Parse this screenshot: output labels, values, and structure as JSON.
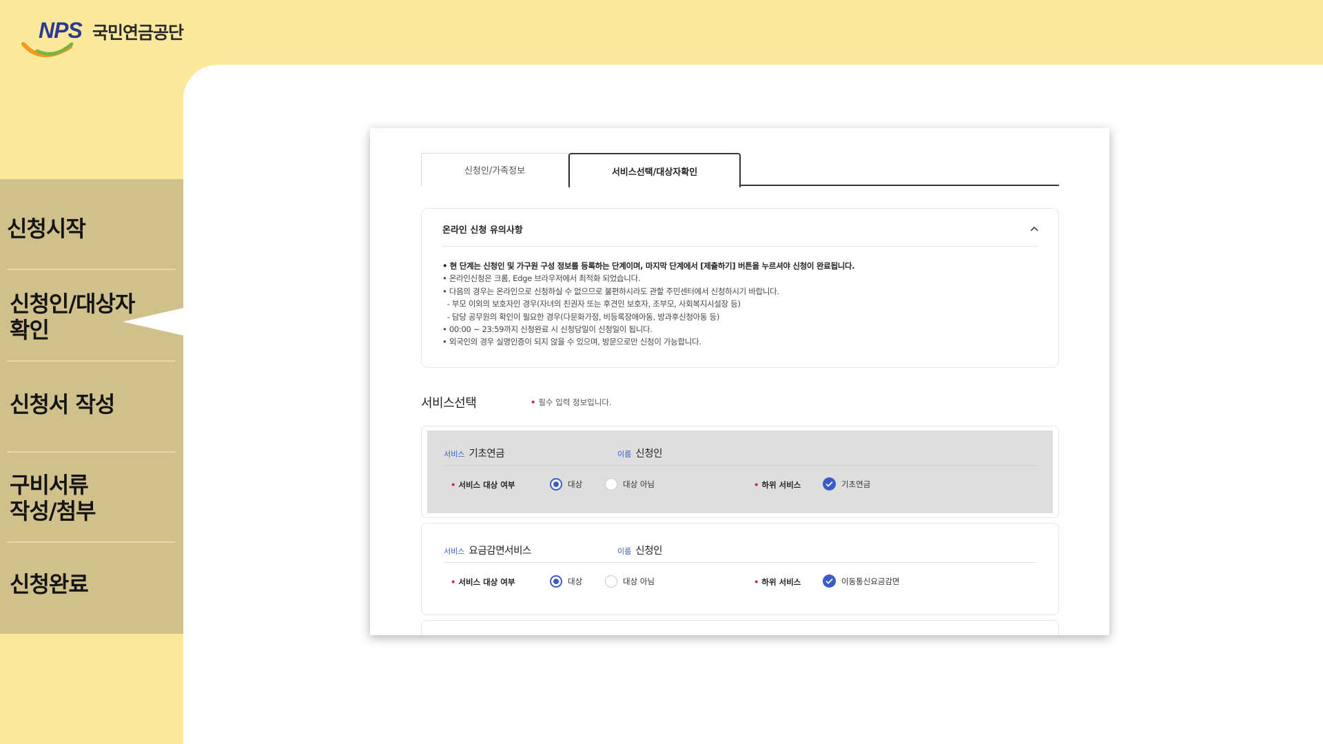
{
  "brand": {
    "logo_text": "NPS",
    "org_name": "국민연금공단",
    "colors": {
      "navy": "#2b3a8f",
      "orange": "#f39b1e",
      "green": "#7cb342"
    }
  },
  "steps": [
    {
      "label": "신청시작"
    },
    {
      "label": "신청인/대상자\n확인",
      "active": true
    },
    {
      "label": "신청서 작성"
    },
    {
      "label": "구비서류\n작성/첨부"
    },
    {
      "label": "신청완료"
    }
  ],
  "tabs": [
    {
      "label": "신청인/가족정보",
      "active": false
    },
    {
      "label": "서비스선택/대상자확인",
      "active": true
    }
  ],
  "notice": {
    "title": "온라인 신청 유의사항",
    "toggle_icon": "chevron-up-icon",
    "lines": [
      "• 현 단계는 신청인 및 가구원 구성 정보를 등록하는 단계이며, 마지막 단계에서 [제출하기] 버튼을 누르셔야 신청이 완료됩니다.",
      "• 온라인신청은 크롬, Edge 브라우저에서 최적화 되었습니다.",
      "• 다음의 경우는 온라인으로 신청하실 수 없으므로 불편하시라도 관할 주민센터에서 신청하시기 바랍니다.",
      "  - 부모 이외의 보호자인 경우(자녀의 친권자 또는 후견인 보호자, 조부모, 사회복지시설장 등)",
      "  - 담당 공무원의 확인이 필요한 경우(다문화가정, 비등록장애아동, 방과후신청아동 등)",
      "• 00:00 ~ 23:59까지 신청완료 시 신청당일이 신청일이 됩니다.",
      "• 외국인의 경우 실명인증이 되지 않을 수 있으며, 방문으로만 신청이 가능합니다."
    ]
  },
  "service_section": {
    "title": "서비스선택",
    "required_mark": "•",
    "required_note": "필수 입력 정보입니다."
  },
  "service_labels": {
    "service": "서비스",
    "name": "이름",
    "target_question": "서비스 대상 여부",
    "option_yes": "대상",
    "option_no": "대상 아님",
    "sub_service": "하위 서비스"
  },
  "services": [
    {
      "service": "기초연금",
      "name": "신청인",
      "selected": "대상",
      "sub_service": "기초연금",
      "sub_checked": true
    },
    {
      "service": "요금감면서비스",
      "name": "신청인",
      "selected": "대상",
      "sub_service": "이동통신요금감면",
      "sub_checked": true
    }
  ],
  "accent_color": "#3b5bc6",
  "required_color": "#d0243a"
}
